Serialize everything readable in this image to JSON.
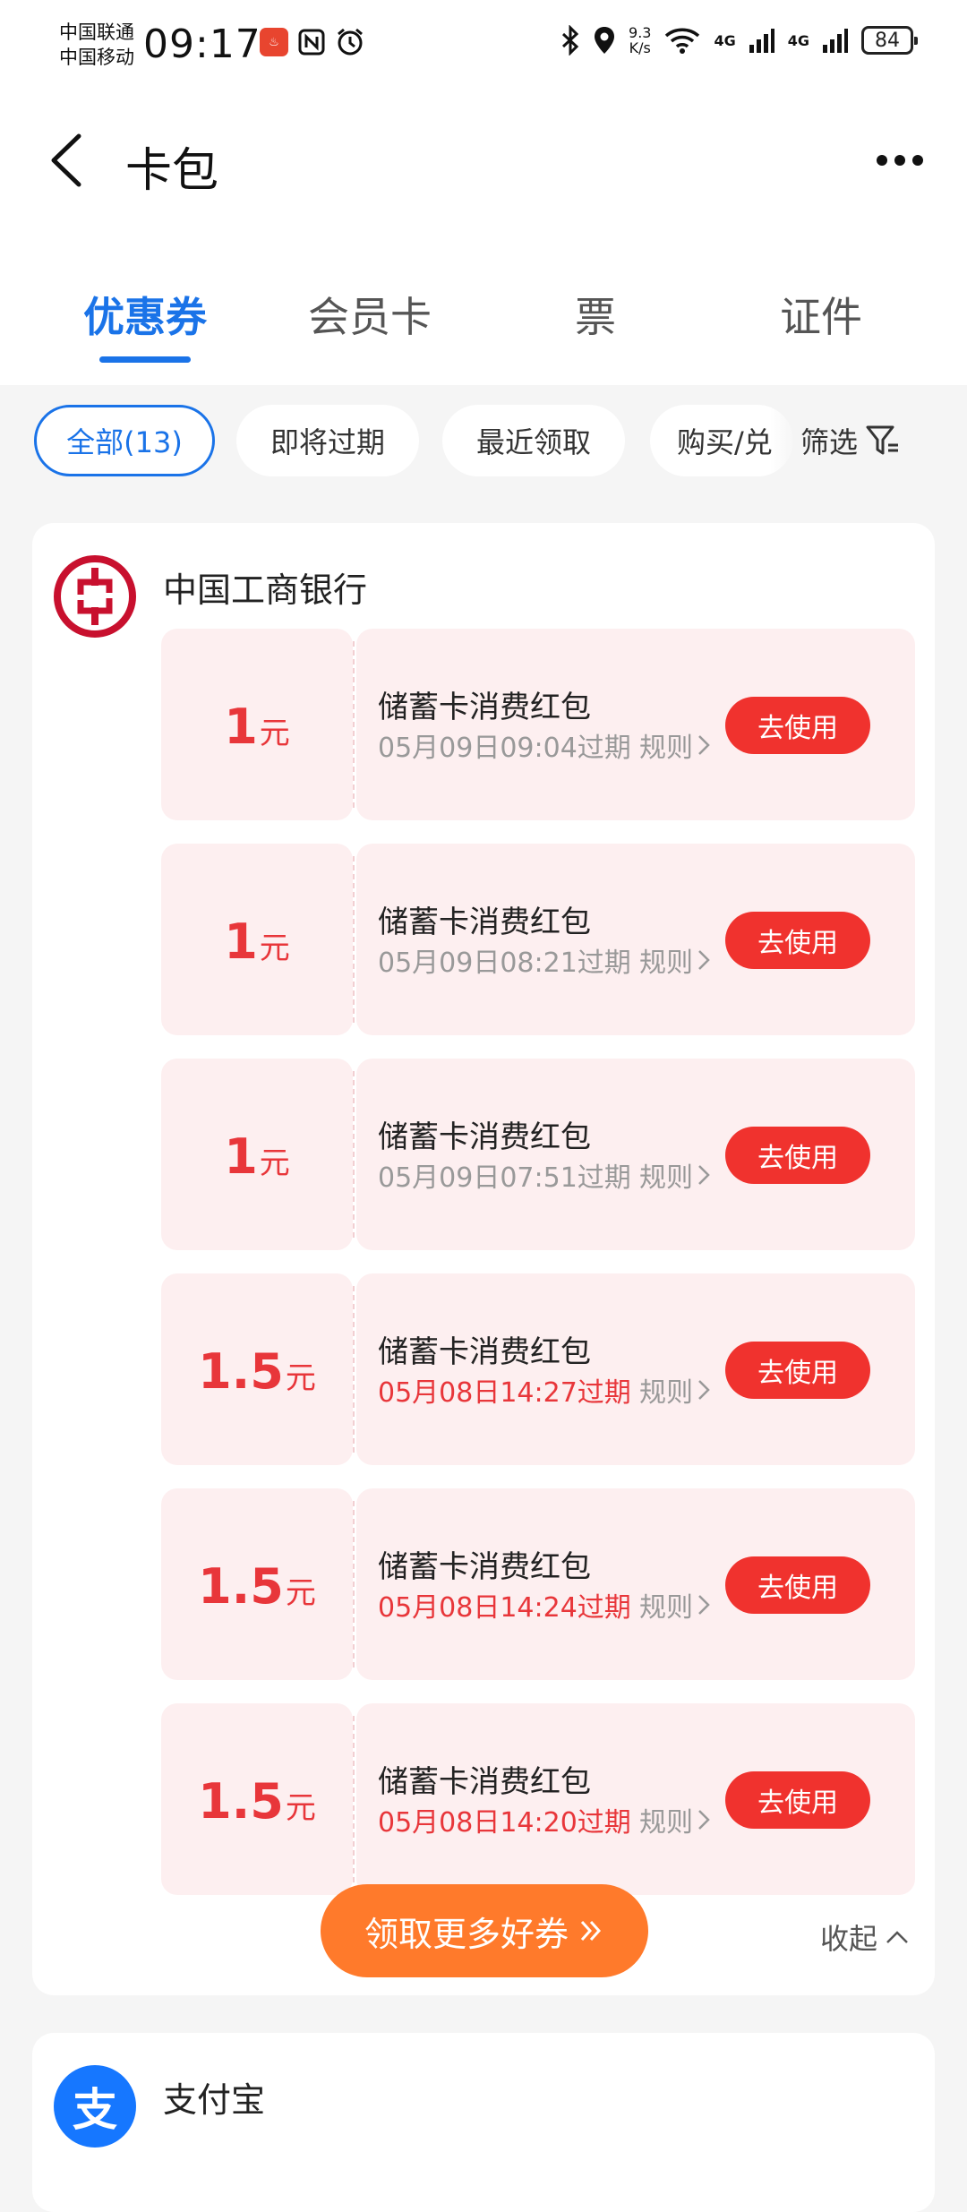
{
  "status_bar": {
    "carrier1": "中国联通",
    "carrier2": "中国移动",
    "time": "09:17",
    "net_speed_value": "9.3",
    "net_speed_unit": "K/s",
    "signal1": "4G",
    "signal2": "4G",
    "battery": "84"
  },
  "header": {
    "title": "卡包"
  },
  "tabs": [
    {
      "label": "优惠券",
      "active": true
    },
    {
      "label": "会员卡",
      "active": false
    },
    {
      "label": "票",
      "active": false
    },
    {
      "label": "证件",
      "active": false
    }
  ],
  "filters": {
    "chips": [
      "全部(13)",
      "即将过期",
      "最近领取",
      "购买/兑"
    ],
    "filter_label": "筛选"
  },
  "bank": {
    "name": "中国工商银行"
  },
  "coupons": [
    {
      "amount": "1",
      "unit": "元",
      "title": "储蓄卡消费红包",
      "expiry": "05月09日09:04过期",
      "urgent": false,
      "rules": "规则",
      "button": "去使用"
    },
    {
      "amount": "1",
      "unit": "元",
      "title": "储蓄卡消费红包",
      "expiry": "05月09日08:21过期",
      "urgent": false,
      "rules": "规则",
      "button": "去使用"
    },
    {
      "amount": "1",
      "unit": "元",
      "title": "储蓄卡消费红包",
      "expiry": "05月09日07:51过期",
      "urgent": false,
      "rules": "规则",
      "button": "去使用"
    },
    {
      "amount": "1.5",
      "unit": "元",
      "title": "储蓄卡消费红包",
      "expiry": "05月08日14:27过期",
      "urgent": true,
      "rules": "规则",
      "button": "去使用"
    },
    {
      "amount": "1.5",
      "unit": "元",
      "title": "储蓄卡消费红包",
      "expiry": "05月08日14:24过期",
      "urgent": true,
      "rules": "规则",
      "button": "去使用"
    },
    {
      "amount": "1.5",
      "unit": "元",
      "title": "储蓄卡消费红包",
      "expiry": "05月08日14:20过期",
      "urgent": true,
      "rules": "规则",
      "button": "去使用"
    }
  ],
  "actions": {
    "more_coupons": "领取更多好券",
    "collapse": "收起"
  },
  "next_section": {
    "name": "支付宝",
    "logo_char": "支"
  },
  "colors": {
    "accent_blue": "#1a73e8",
    "coupon_red": "#e8363a",
    "button_red": "#f0322e",
    "coupon_bg": "#fdeff0",
    "orange_button": "#ff7a2b",
    "bank_red": "#c8102e",
    "alipay_blue": "#1677ff"
  }
}
